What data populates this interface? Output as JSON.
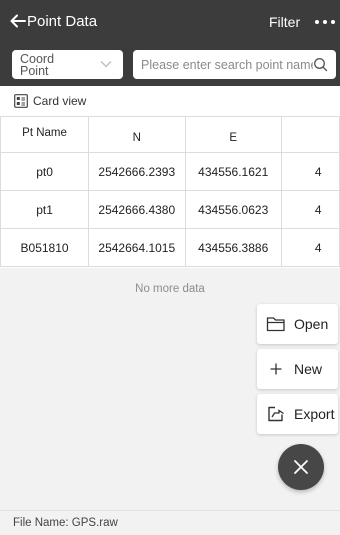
{
  "header": {
    "back_icon": "arrow-left-icon",
    "title": "Point Data",
    "filter_label": "Filter",
    "more_icon": "more-horizontal-icon"
  },
  "search": {
    "coord_select_value": "Coord Point",
    "placeholder": "Please enter search point name",
    "value": "",
    "search_icon": "search-icon"
  },
  "card_view": {
    "icon": "card-view-icon",
    "label": "Card view"
  },
  "table": {
    "columns": [
      "Pt Name",
      "N",
      "E",
      ""
    ],
    "rows": [
      [
        "pt0",
        "2542666.2393",
        "434556.1621",
        "4"
      ],
      [
        "pt1",
        "2542666.4380",
        "434556.0623",
        "4"
      ],
      [
        "B051810",
        "2542664.1015",
        "434556.3886",
        "4"
      ]
    ]
  },
  "status": {
    "no_more": "No more data"
  },
  "fab_menu": {
    "open_label": "Open",
    "new_label": "New",
    "export_label": "Export",
    "close_icon": "close-icon"
  },
  "footer": {
    "file_name": "File Name: GPS.raw"
  },
  "colors": {
    "header_bg": "#3c3c3c",
    "overlay_bg": "#f2f2f2",
    "fab_bg": "#474747"
  }
}
